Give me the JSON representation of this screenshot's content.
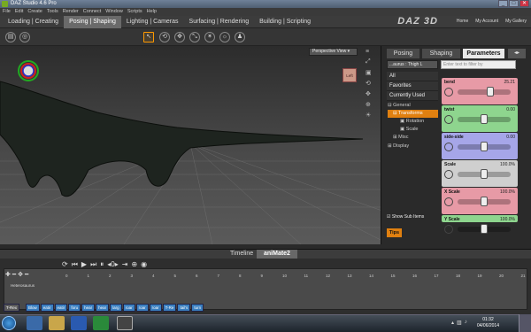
{
  "window": {
    "title": "DAZ Studio 4.6 Pro"
  },
  "menu": [
    "File",
    "Edit",
    "Create",
    "Tools",
    "Render",
    "Connect",
    "Window",
    "Scripts",
    "Help"
  ],
  "main_tabs": [
    {
      "label": "Loading | Creating",
      "active": false
    },
    {
      "label": "Posing | Shaping",
      "active": true
    },
    {
      "label": "Lighting | Cameras",
      "active": false
    },
    {
      "label": "Surfacing | Rendering",
      "active": false
    },
    {
      "label": "Building | Scripting",
      "active": false
    }
  ],
  "brand": {
    "logo": "DAZ 3D",
    "links": [
      "Home",
      "My Account",
      "My Gallery"
    ]
  },
  "viewport": {
    "view_label": "Perspective View",
    "cube_label": "Left"
  },
  "panel": {
    "tabs": [
      "Posing",
      "Shaping",
      "Parameters"
    ],
    "active_tab": "Parameters",
    "node_selector": "...aurus : Thigh L",
    "filter_placeholder": "Enter text to filter by",
    "categories": [
      "All",
      "Favorites",
      "Currently Used"
    ],
    "tree": [
      "General",
      "Transforms",
      "Rotation",
      "Scale",
      "Misc",
      "Display"
    ],
    "params": [
      {
        "label": "bend",
        "value": "25.21",
        "color": "#e79aa6",
        "knob": 0.62
      },
      {
        "label": "twist",
        "value": "0.00",
        "color": "#8ed58e",
        "knob": 0.5
      },
      {
        "label": "side-side",
        "value": "0.00",
        "color": "#a6a6e8",
        "knob": 0.5
      },
      {
        "label": "Scale",
        "value": "100.0%",
        "color": "#cfcfcf",
        "knob": 0.5
      },
      {
        "label": "X Scale",
        "value": "100.0%",
        "color": "#e79aa6",
        "knob": 0.5
      },
      {
        "label": "Y Scale",
        "value": "100.0%",
        "color": "#8ed58e",
        "knob": 0.5
      }
    ],
    "show_sub_items": "Show Sub Items",
    "tips": "Tips"
  },
  "bottom": {
    "tabs": [
      "Timeline",
      "aniMate2"
    ],
    "active": "aniMate2",
    "track_name": "Heterosaurus",
    "ruler": [
      "0",
      "1",
      "2",
      "3",
      "4",
      "5",
      "6",
      "7",
      "8",
      "9",
      "10",
      "11",
      "12",
      "13",
      "14",
      "15",
      "16",
      "17",
      "18",
      "19",
      "20",
      "21",
      "22"
    ],
    "keys": [
      "T-Rex",
      "Blow",
      "eatir",
      "eatir",
      "foru",
      "hear",
      "hear",
      "larg",
      "roar",
      "roar",
      "roar",
      "T-Re",
      "tail's",
      "turn"
    ]
  },
  "taskbar": {
    "time": "01:32",
    "date": "04/06/2014"
  }
}
